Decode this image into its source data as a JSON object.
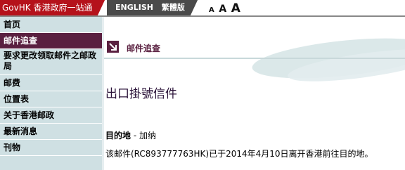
{
  "header": {
    "gov_label": "GovHK 香港政府一站通",
    "lang_english": "ENGLISH",
    "lang_traditional": "繁體版",
    "font_small": "A",
    "font_medium": "A",
    "font_large": "A"
  },
  "sidebar": {
    "items": [
      {
        "label": "首页"
      },
      {
        "label": "邮件追查"
      },
      {
        "label": "要求更改领取邮件之邮政局"
      },
      {
        "label": "邮费"
      },
      {
        "label": "位置表"
      },
      {
        "label": "关于香港邮政"
      },
      {
        "label": "最新消息"
      },
      {
        "label": "刊物"
      }
    ]
  },
  "main": {
    "section_title": "邮件追查",
    "heading": "出口掛號信件",
    "destination_label": "目的地",
    "destination_sep": " - ",
    "destination_value": "加纳",
    "status_text": "该邮件(RC893777763HK)已于2014年4月10日离开香港前往目的地。"
  },
  "colors": {
    "gov_red": "#b5121b",
    "lang_gray": "#4a4a4a",
    "sidebar_bg": "#cfe0e3",
    "active_purple": "#5a2040"
  }
}
